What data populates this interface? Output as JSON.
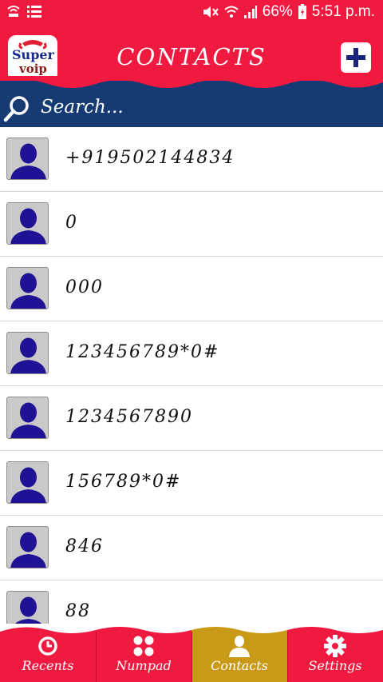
{
  "status_bar": {
    "battery": "66%",
    "time": "5:51 p.m."
  },
  "header": {
    "logo_line1": "Super",
    "logo_line2": "voip",
    "title": "CONTACTS"
  },
  "search": {
    "placeholder": "Search..."
  },
  "contacts": [
    {
      "name": "+919502144834"
    },
    {
      "name": "0"
    },
    {
      "name": "000"
    },
    {
      "name": "123456789*0#"
    },
    {
      "name": "1234567890"
    },
    {
      "name": "156789*0#"
    },
    {
      "name": "846"
    },
    {
      "name": "88"
    }
  ],
  "bottom_nav": {
    "tabs": [
      {
        "label": "Recents",
        "icon": "clock-icon"
      },
      {
        "label": "Numpad",
        "icon": "dialpad-icon"
      },
      {
        "label": "Contacts",
        "icon": "person-icon",
        "active": true
      },
      {
        "label": "Settings",
        "icon": "gear-icon"
      }
    ]
  },
  "colors": {
    "primary": "#f0193f",
    "search_bg": "#163a73",
    "active_tab": "#c89a16",
    "avatar_bg": "#c9c9c9",
    "avatar_figure": "#1f1294"
  }
}
